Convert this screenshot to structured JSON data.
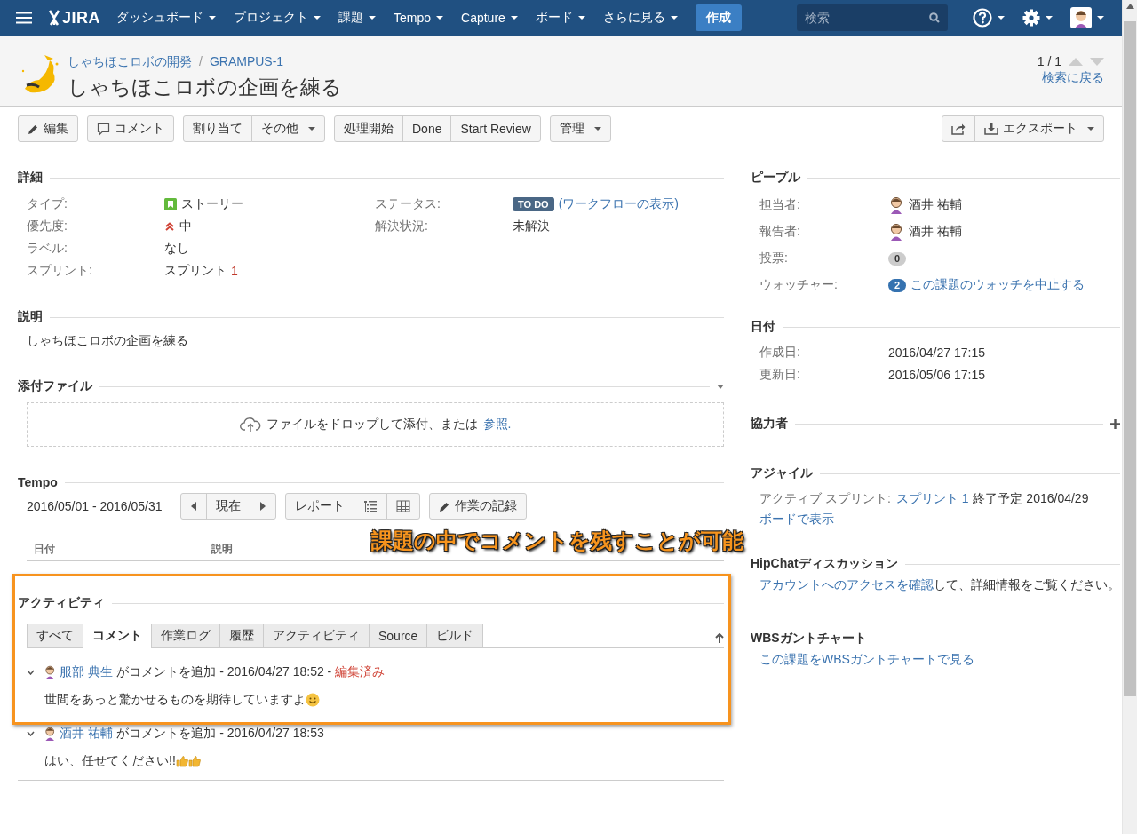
{
  "nav": {
    "logo": "JIRA",
    "items": [
      {
        "label": "ダッシュボード",
        "dropdown": true
      },
      {
        "label": "プロジェクト",
        "dropdown": true
      },
      {
        "label": "課題",
        "dropdown": true
      },
      {
        "label": "Tempo",
        "dropdown": true
      },
      {
        "label": "Capture",
        "dropdown": true
      },
      {
        "label": "ボード",
        "dropdown": true
      },
      {
        "label": "さらに見る",
        "dropdown": true
      }
    ],
    "create": "作成",
    "search": {
      "placeholder": "検索"
    }
  },
  "breadcrumb": {
    "project": "しゃちほこロボの開発",
    "separator": "/",
    "key": "GRAMPUS-1"
  },
  "title": "しゃちほこロボの企画を練る",
  "pager": {
    "position": "1 / 1",
    "back": "検索に戻る"
  },
  "toolbar": {
    "groups": [
      [
        {
          "label": "編集",
          "kind": "edit"
        }
      ],
      [
        {
          "label": "コメント",
          "kind": "comment"
        }
      ],
      [
        {
          "label": "割り当て"
        },
        {
          "label": "その他",
          "dropdown": true
        }
      ],
      [
        {
          "label": "処理開始"
        },
        {
          "label": "Done"
        },
        {
          "label": "Start Review"
        }
      ],
      [
        {
          "label": "管理",
          "dropdown": true
        }
      ]
    ],
    "right_groups": [
      [
        {
          "kind": "share"
        },
        {
          "label": "エクスポート",
          "kind": "export",
          "dropdown": true
        }
      ]
    ]
  },
  "details": {
    "heading": "詳細",
    "columns": [
      [
        {
          "label": "タイプ:",
          "kind": "story",
          "value": "ストーリー"
        },
        {
          "label": "優先度:",
          "kind": "priority",
          "value": "中"
        },
        {
          "label": "ラベル:",
          "value": "なし"
        },
        {
          "label": "スプリント:",
          "value": "スプリント",
          "sprint": "1"
        }
      ],
      [
        {
          "label": "ステータス:",
          "badge": "TO DO",
          "link": "(ワークフローの表示)"
        },
        {
          "label": "解決状況:",
          "value": "未解決"
        }
      ]
    ]
  },
  "description": {
    "heading": "説明",
    "text": "しゃちほこロボの企画を練る"
  },
  "attachments": {
    "heading": "添付ファイル",
    "drop_text": "ファイルをドロップして添付、または",
    "browse": "参照."
  },
  "tempo": {
    "heading": "Tempo",
    "range": "2016/05/01 - 2016/05/31",
    "groups": [
      [
        {
          "kind": "prev"
        },
        {
          "label": "現在"
        },
        {
          "kind": "next"
        }
      ],
      [
        {
          "label": "レポート"
        },
        {
          "kind": "list"
        },
        {
          "kind": "grid"
        }
      ],
      [
        {
          "label": "作業の記録",
          "kind": "edit"
        }
      ]
    ],
    "columns": [
      "日付",
      "説明"
    ]
  },
  "activity": {
    "heading": "アクティビティ",
    "tabs": [
      {
        "label": "すべて",
        "selected": false
      },
      {
        "label": "コメント",
        "selected": true
      },
      {
        "label": "作業ログ",
        "selected": false
      },
      {
        "label": "履歴",
        "selected": false
      },
      {
        "label": "アクティビティ",
        "selected": false
      },
      {
        "label": "Source",
        "selected": false
      },
      {
        "label": "ビルド",
        "selected": false
      }
    ],
    "comments": [
      {
        "expanded": true,
        "author": "服部 典生",
        "meta": "がコメントを追加 - 2016/04/27 18:52 -",
        "edited": "編集済み",
        "body": "世間をあっと驚かせるものを期待していますよ",
        "emoji": [
          {
            "kind": "smile"
          }
        ]
      },
      {
        "expanded": true,
        "author": "酒井 祐輔",
        "meta": "がコメントを追加 - 2016/04/27 18:53",
        "body": "はい、任せてください!!",
        "emoji": [
          {
            "kind": "thumbs-up"
          },
          {
            "kind": "thumbs-up"
          }
        ]
      }
    ]
  },
  "annotation": {
    "text": "課題の中でコメントを残すことが可能"
  },
  "people": {
    "heading": "ピープル",
    "fields": [
      {
        "label": "担当者:",
        "user": "酒井 祐輔"
      },
      {
        "label": "報告者:",
        "user": "酒井 祐輔"
      },
      {
        "label": "投票:",
        "count": "0",
        "active": false
      },
      {
        "label": "ウォッチャー:",
        "count": "2",
        "active": true,
        "link": "この課題のウォッチを中止する"
      }
    ]
  },
  "dates": {
    "heading": "日付",
    "fields": [
      {
        "label": "作成日:",
        "value": "2016/04/27 17:15"
      },
      {
        "label": "更新日:",
        "value": "2016/05/06 17:15"
      }
    ]
  },
  "collaborators": {
    "heading": "協力者"
  },
  "agile": {
    "heading": "アジャイル",
    "fields": [
      {
        "label": "アクティブ スプリント:",
        "link": "スプリント 1",
        "value": "終了予定 2016/04/29"
      }
    ],
    "board_link": "ボードで表示"
  },
  "hipchat": {
    "heading": "HipChatディスカッション",
    "link": "アカウントへのアクセスを確認",
    "text": "して、詳細情報をご覧ください。"
  },
  "wbs": {
    "heading": "WBSガントチャート",
    "link": "この課題をWBSガントチャートで見る"
  }
}
